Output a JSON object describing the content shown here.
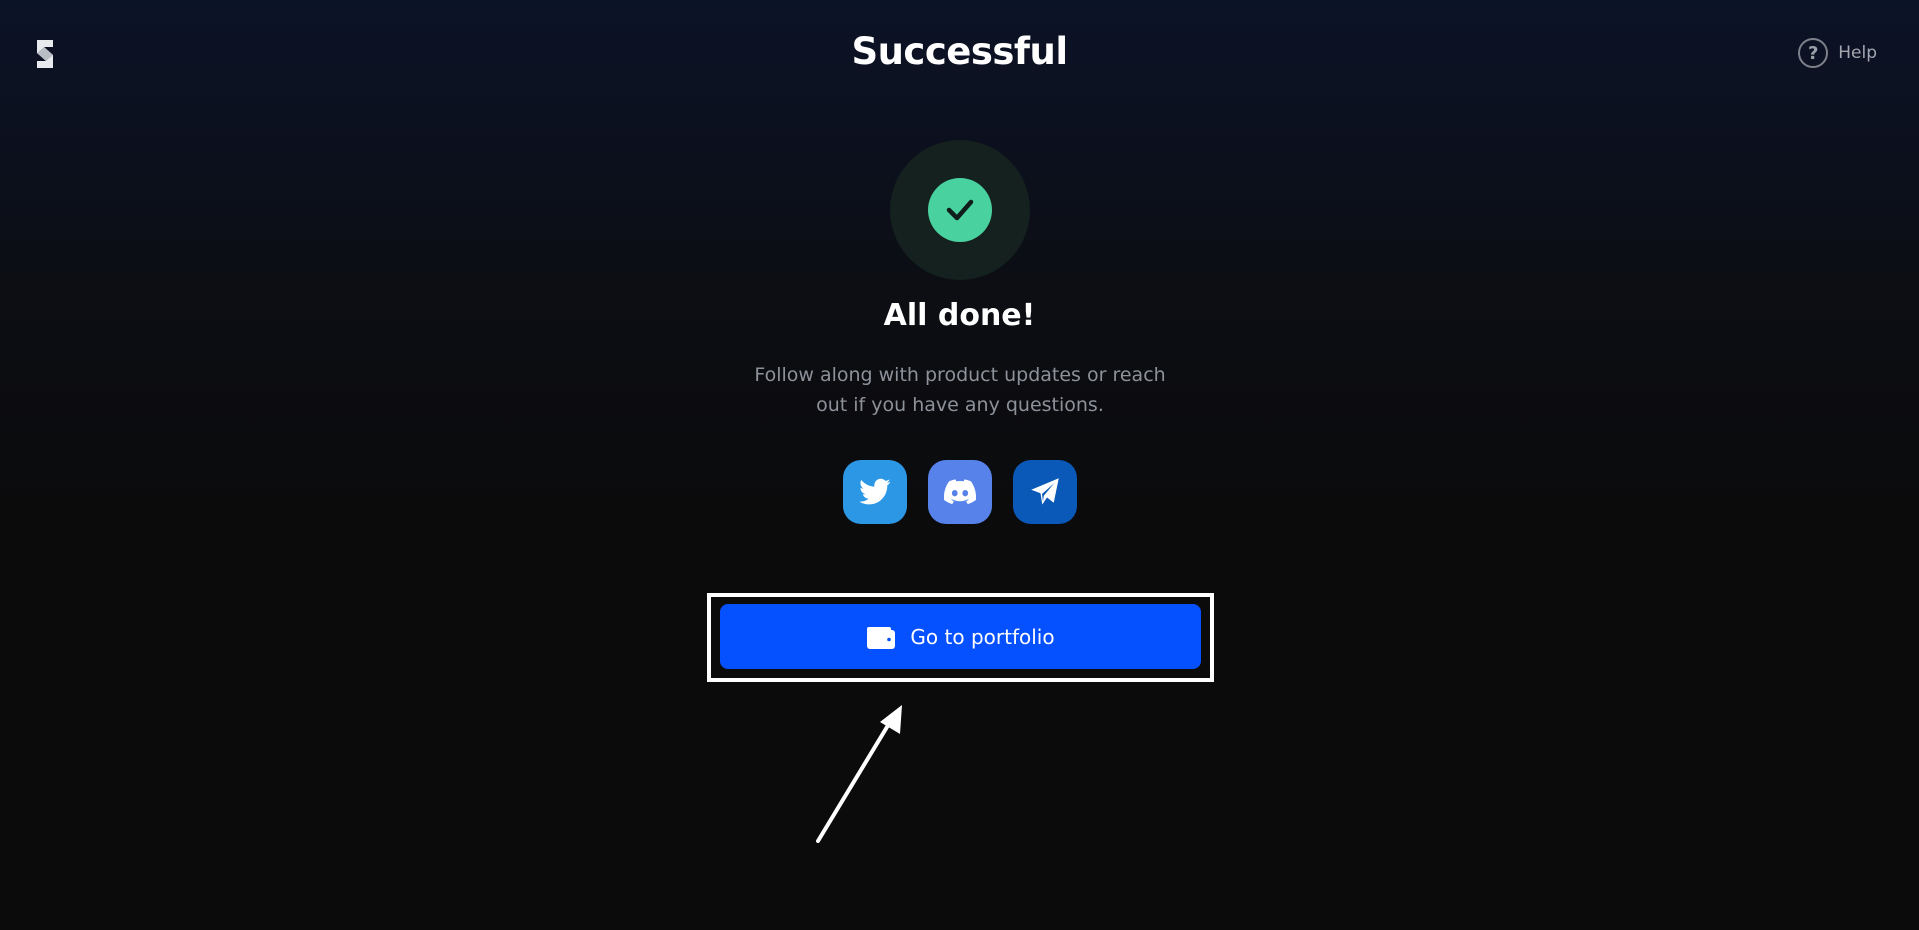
{
  "header": {
    "title": "Successful",
    "logo_icon": "brand-s-logo-icon",
    "help_label": "Help",
    "help_icon": "question-circle-icon"
  },
  "status": {
    "icon": "check-circle-icon",
    "accent_color": "#49d29f",
    "heading": "All done!",
    "message": "Follow along with product updates or reach out if you have any questions."
  },
  "socials": [
    {
      "name": "twitter",
      "icon": "twitter-icon",
      "color": "#2c97e4"
    },
    {
      "name": "discord",
      "icon": "discord-icon",
      "color": "#5682ea"
    },
    {
      "name": "telegram",
      "icon": "telegram-icon",
      "color": "#0a58b8"
    }
  ],
  "cta": {
    "label": "Go to portfolio",
    "icon": "wallet-icon",
    "color": "#0550ff"
  }
}
